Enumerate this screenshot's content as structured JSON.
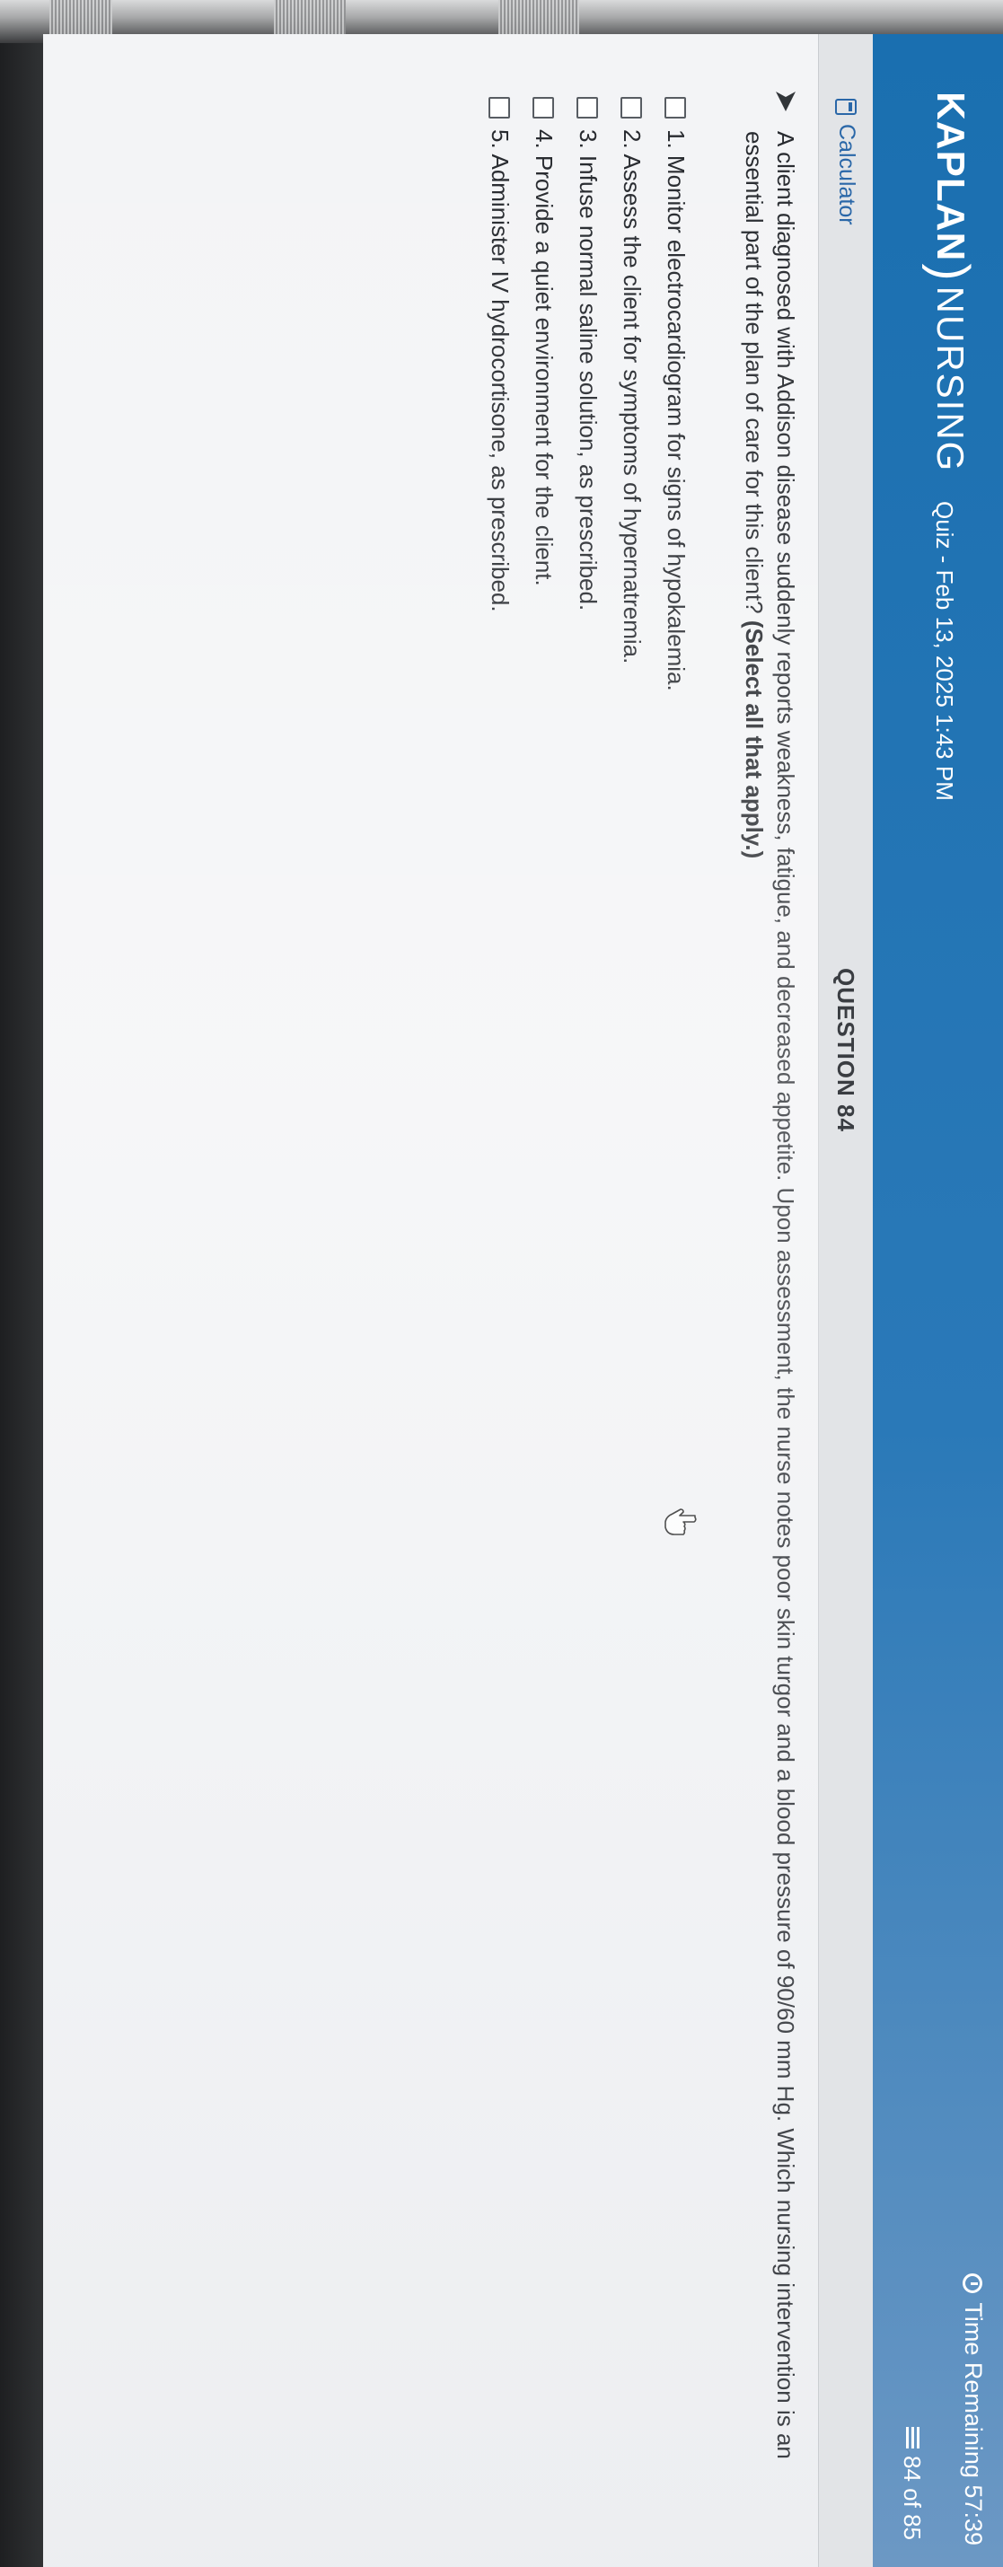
{
  "header": {
    "brand_primary": "KAPLAN",
    "brand_secondary": "NURSING",
    "quiz_title": "Quiz - Feb 13, 2025 1:43 PM",
    "time_remaining": "Time Remaining 57:39",
    "progress": "84 of 85",
    "accent_color": "#1a6fb0"
  },
  "toolbar": {
    "calculator_label": "Calculator",
    "question_number": "QUESTION 84"
  },
  "question": {
    "stem": "A client diagnosed with Addison disease suddenly reports weakness, fatigue, and decreased appetite. Upon assessment, the nurse notes poor skin turgor and a blood pressure of 90/60 mm Hg. Which nursing intervention is an essential part of the plan of care for this client?",
    "instruction": "(Select all that apply.)",
    "options": [
      {
        "label": "1. Monitor electrocardiogram for signs of hypokalemia.",
        "checked": false
      },
      {
        "label": "2. Assess the client for symptoms of hypernatremia.",
        "checked": false
      },
      {
        "label": "3. Infuse normal saline solution, as prescribed.",
        "checked": false
      },
      {
        "label": "4. Provide a quiet environment for the client.",
        "checked": false
      },
      {
        "label": "5. Administer IV hydrocortisone, as prescribed.",
        "checked": false
      }
    ]
  },
  "icons": {
    "clock": "clock-icon",
    "list": "list-icon",
    "calculator": "calculator-icon",
    "arrow": "arrow-icon",
    "cursor": "hand-pointer-icon"
  }
}
